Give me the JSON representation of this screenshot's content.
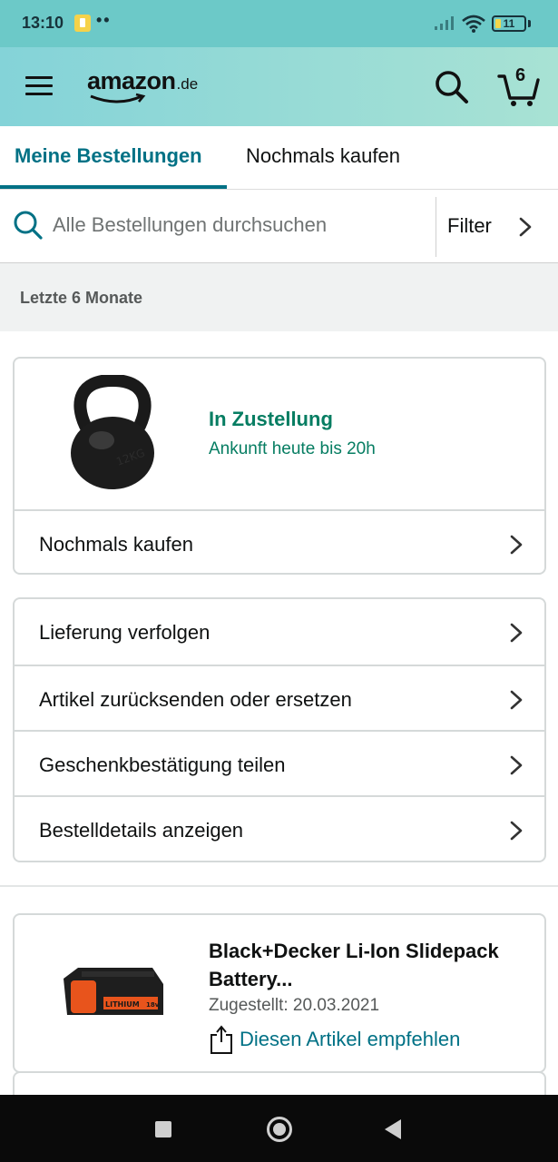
{
  "status_bar": {
    "time": "13:10",
    "dots": "••",
    "battery": "11",
    "icons": [
      "notification-icon",
      "signal-icon",
      "wifi-icon",
      "battery-icon"
    ]
  },
  "header": {
    "logo_main": "amazon",
    "logo_tld": ".de",
    "cart_count": "6",
    "icons": [
      "menu-icon",
      "search-icon",
      "cart-icon"
    ]
  },
  "tabs": {
    "active": "Meine Bestellungen",
    "other": "Nochmals kaufen"
  },
  "search": {
    "placeholder": "Alle Bestellungen durchsuchen",
    "value": "",
    "filter_label": "Filter"
  },
  "section": {
    "label": "Letzte 6 Monate"
  },
  "order1": {
    "product_image": "kettlebell",
    "status_title": "In Zustellung",
    "status_sub": "Ankunft heute bis 20h",
    "buy_again": "Nochmals kaufen",
    "actions": [
      {
        "label": "Lieferung verfolgen"
      },
      {
        "label": "Artikel zurücksenden oder ersetzen"
      },
      {
        "label": "Geschenkbestätigung teilen"
      },
      {
        "label": "Bestelldetails anzeigen"
      }
    ]
  },
  "order2": {
    "product_image": "battery",
    "title": "Black+Decker Li-Ion Slidepack Battery...",
    "delivered": "Zugestellt: 20.03.2021",
    "recommend": "Diesen Artikel empfehlen",
    "battery_label": "LITHIUM",
    "battery_voltage": "18v"
  },
  "colors": {
    "accent": "#007185",
    "status_green": "#067d62",
    "header_start": "#84d3d8",
    "header_end": "#a8e2d4",
    "statusbar": "#6cc9c8"
  }
}
